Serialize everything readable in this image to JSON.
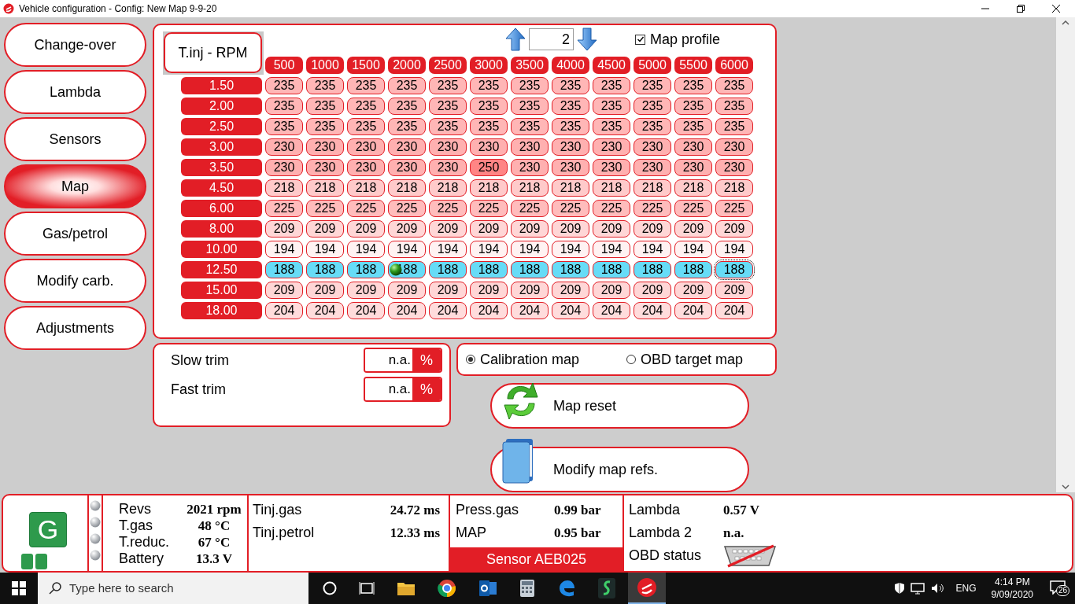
{
  "window": {
    "title": "Vehicle configuration - Config: New Map 9-9-20"
  },
  "nav": [
    {
      "label": "Change-over",
      "selected": false
    },
    {
      "label": "Lambda",
      "selected": false
    },
    {
      "label": "Sensors",
      "selected": false
    },
    {
      "label": "Map",
      "selected": true
    },
    {
      "label": "Gas/petrol",
      "selected": false
    },
    {
      "label": "Modify carb.",
      "selected": false
    },
    {
      "label": "Adjustments",
      "selected": false
    }
  ],
  "map": {
    "title": "T.inj - RPM",
    "profile_number": "2",
    "map_profile": {
      "label": "Map profile",
      "checked": true
    },
    "columns": [
      "500",
      "1000",
      "1500",
      "2000",
      "2500",
      "3000",
      "3500",
      "4000",
      "4500",
      "5000",
      "5500",
      "6000"
    ],
    "rows": [
      {
        "label": "1.50",
        "selected": false,
        "color": "#ffb6b6",
        "cells": [
          "235",
          "235",
          "235",
          "235",
          "235",
          "235",
          "235",
          "235",
          "235",
          "235",
          "235",
          "235"
        ]
      },
      {
        "label": "2.00",
        "selected": false,
        "color": "#ffb6b6",
        "cells": [
          "235",
          "235",
          "235",
          "235",
          "235",
          "235",
          "235",
          "235",
          "235",
          "235",
          "235",
          "235"
        ]
      },
      {
        "label": "2.50",
        "selected": false,
        "color": "#ffb6b6",
        "cells": [
          "235",
          "235",
          "235",
          "235",
          "235",
          "235",
          "235",
          "235",
          "235",
          "235",
          "235",
          "235"
        ]
      },
      {
        "label": "3.00",
        "selected": false,
        "color": "#ffb0b0",
        "cells": [
          "230",
          "230",
          "230",
          "230",
          "230",
          "230",
          "230",
          "230",
          "230",
          "230",
          "230",
          "230"
        ]
      },
      {
        "label": "3.50",
        "selected": false,
        "color": "#ffb0b0",
        "cells": [
          "230",
          "230",
          "230",
          "230",
          "230",
          {
            "value": "250",
            "hot": true
          },
          "230",
          "230",
          "230",
          "230",
          "230",
          "230"
        ]
      },
      {
        "label": "4.50",
        "selected": false,
        "color": "#ffcaca",
        "cells": [
          "218",
          "218",
          "218",
          "218",
          "218",
          "218",
          "218",
          "218",
          "218",
          "218",
          "218",
          "218"
        ]
      },
      {
        "label": "6.00",
        "selected": false,
        "color": "#ffbcbc",
        "cells": [
          "225",
          "225",
          "225",
          "225",
          "225",
          "225",
          "225",
          "225",
          "225",
          "225",
          "225",
          "225"
        ]
      },
      {
        "label": "8.00",
        "selected": false,
        "color": "#ffd6d6",
        "cells": [
          "209",
          "209",
          "209",
          "209",
          "209",
          "209",
          "209",
          "209",
          "209",
          "209",
          "209",
          "209"
        ]
      },
      {
        "label": "10.00",
        "selected": false,
        "color": "#fff2f2",
        "cells": [
          "194",
          "194",
          "194",
          "194",
          "194",
          "194",
          "194",
          "194",
          "194",
          "194",
          "194",
          "194"
        ]
      },
      {
        "label": "12.50",
        "selected": true,
        "cells": [
          "188",
          "188",
          "188",
          {
            "value": "188",
            "marker": true
          },
          "188",
          "188",
          "188",
          "188",
          "188",
          "188",
          "188",
          {
            "value": "188",
            "focused": true
          }
        ]
      },
      {
        "label": "15.00",
        "selected": false,
        "color": "#ffd6d6",
        "cells": [
          "209",
          "209",
          "209",
          "209",
          "209",
          "209",
          "209",
          "209",
          "209",
          "209",
          "209",
          "209"
        ]
      },
      {
        "label": "18.00",
        "selected": false,
        "color": "#ffdcdc",
        "cells": [
          "204",
          "204",
          "204",
          "204",
          "204",
          "204",
          "204",
          "204",
          "204",
          "204",
          "204",
          "204"
        ]
      }
    ]
  },
  "trims": [
    {
      "label": "Slow trim",
      "value": "n.a.",
      "unit": "%"
    },
    {
      "label": "Fast trim",
      "value": "n.a.",
      "unit": "%"
    }
  ],
  "map_type": [
    {
      "label": "Calibration map",
      "selected": true
    },
    {
      "label": "OBD target map",
      "selected": false
    }
  ],
  "actions": [
    {
      "label": "Map reset",
      "kind": "reset"
    },
    {
      "label": "Modify map refs.",
      "kind": "refs"
    }
  ],
  "status": {
    "logo": "G",
    "readings": [
      {
        "label": "Revs",
        "value": "2021 rpm"
      },
      {
        "label": "T.gas",
        "value": "48 °C"
      },
      {
        "label": "T.reduc.",
        "value": "67 °C"
      },
      {
        "label": "Battery",
        "value": "13.3 V"
      }
    ],
    "injection": [
      {
        "label": "Tinj.gas",
        "value": "24.72 ms"
      },
      {
        "label": "Tinj.petrol",
        "value": "12.33 ms"
      }
    ],
    "pressure": [
      {
        "label": "Press.gas",
        "value": "0.99 bar"
      },
      {
        "label": "MAP",
        "value": "0.95 bar"
      }
    ],
    "sensor": "Sensor AEB025",
    "lambda": [
      {
        "label": "Lambda",
        "value": "0.57 V",
        "kind": "value"
      },
      {
        "label": "Lambda 2",
        "value": "n.a.",
        "kind": "value"
      },
      {
        "label": "OBD status",
        "kind": "obd"
      }
    ]
  },
  "taskbar": {
    "search_placeholder": "Type here to search",
    "language": "ENG",
    "time": "4:14 PM",
    "date": "9/09/2020",
    "notifications": "26"
  }
}
